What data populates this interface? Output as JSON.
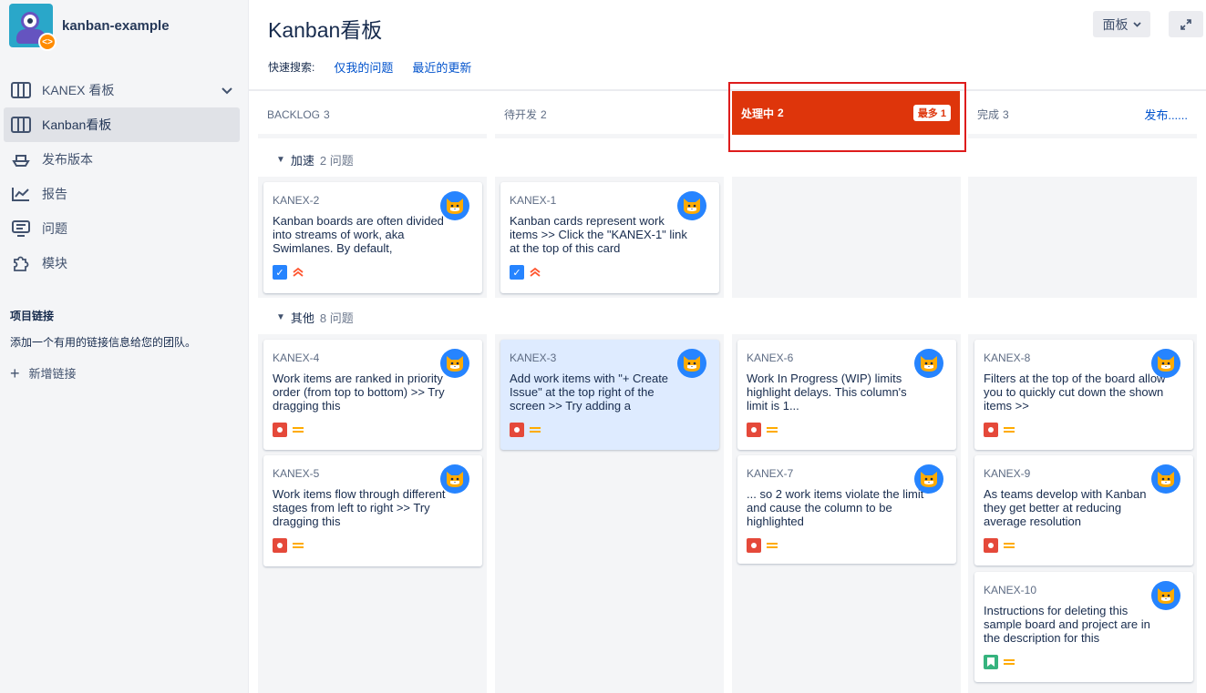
{
  "project": {
    "name": "kanban-example",
    "badge": "‹›"
  },
  "sidebar": {
    "board_selector": "KANEX 看板",
    "items": [
      {
        "label": "Kanban看板",
        "icon": "board-icon",
        "active": true
      },
      {
        "label": "发布版本",
        "icon": "ship-icon",
        "active": false
      },
      {
        "label": "报告",
        "icon": "chart-line-icon",
        "active": false
      },
      {
        "label": "问题",
        "icon": "issues-icon",
        "active": false
      },
      {
        "label": "模块",
        "icon": "puzzle-icon",
        "active": false
      }
    ],
    "links_title": "项目链接",
    "links_desc": "添加一个有用的链接信息给您的团队。",
    "add_link": "新增链接"
  },
  "header": {
    "title": "Kanban看板",
    "board_button": "面板",
    "quick_search_label": "快速搜索:",
    "quick_filters": [
      "仅我的问题",
      "最近的更新"
    ]
  },
  "columns": [
    {
      "name": "BACKLOG",
      "count": "3"
    },
    {
      "name": "待开发",
      "count": "2"
    },
    {
      "name": "处理中",
      "count": "2",
      "limit": "最多 1"
    },
    {
      "name": "完成",
      "count": "3",
      "action": "发布......"
    }
  ],
  "swimlanes": [
    {
      "name": "加速",
      "count": "2 问题"
    },
    {
      "name": "其他",
      "count": "8 问题"
    }
  ],
  "cards": {
    "kanex2": {
      "key": "KANEX-2",
      "summary": "Kanban boards are often divided into streams of work, aka Swimlanes. By default,",
      "type": "task",
      "priority": "highest"
    },
    "kanex1": {
      "key": "KANEX-1",
      "summary": "Kanban cards represent work items >> Click the \"KANEX-1\" link at the top of this card",
      "type": "task",
      "priority": "highest"
    },
    "kanex4": {
      "key": "KANEX-4",
      "summary": "Work items are ranked in priority order (from top to bottom) >> Try dragging this",
      "type": "bug",
      "priority": "medium"
    },
    "kanex5": {
      "key": "KANEX-5",
      "summary": "Work items flow through different stages from left to right >> Try dragging this",
      "type": "bug",
      "priority": "medium"
    },
    "kanex3": {
      "key": "KANEX-3",
      "summary": "Add work items with \"+ Create Issue\" at the top right of the screen >> Try adding a",
      "type": "bug",
      "priority": "medium"
    },
    "kanex6": {
      "key": "KANEX-6",
      "summary": "Work In Progress (WIP) limits highlight delays. This column's limit is 1...",
      "type": "bug",
      "priority": "medium"
    },
    "kanex7": {
      "key": "KANEX-7",
      "summary": "... so 2 work items violate the limit and cause the column to be highlighted",
      "type": "bug",
      "priority": "medium"
    },
    "kanex8": {
      "key": "KANEX-8",
      "summary": "Filters at the top of the board allow you to quickly cut down the shown items >>",
      "type": "bug",
      "priority": "medium"
    },
    "kanex9": {
      "key": "KANEX-9",
      "summary": "As teams develop with Kanban they get better at reducing average resolution",
      "type": "bug",
      "priority": "medium"
    },
    "kanex10": {
      "key": "KANEX-10",
      "summary": "Instructions for deleting this sample board and project are in the description for this",
      "type": "story",
      "priority": "medium"
    }
  },
  "colors": {
    "accent": "#0052cc",
    "limit_exceeded": "#de350b",
    "highlight_box": "#de1c1c",
    "bug": "#e5493a",
    "task": "#2684ff",
    "story": "#36b37e",
    "priority_medium": "#ffab00",
    "priority_highest": "#ff5630"
  }
}
